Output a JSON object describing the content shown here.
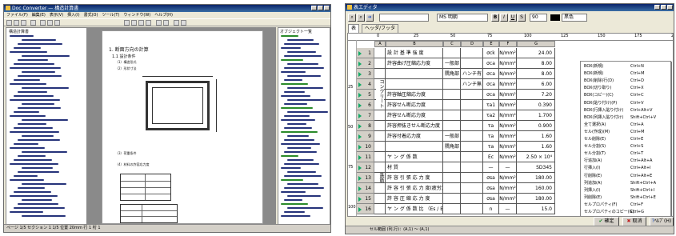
{
  "left_window": {
    "title": "Doc Converter — 構造計算書",
    "menus": [
      "ファイル(F)",
      "編集(E)",
      "表示(V)",
      "挿入(I)",
      "書式(O)",
      "ツール(T)",
      "ウィンドウ(W)",
      "ヘルプ(H)"
    ],
    "outline_title": "構造計算書",
    "page_heading": "1. 断面方向の計算",
    "page_sub1": "1.1 設計条件",
    "page_sub2": "（1）構造形式",
    "page_note": "（2）形状寸法",
    "page_caption": "（3）荷重条件",
    "page_caption2": "（4）材料の許容応力度",
    "status_text": "ページ 1/5   セクション 1   1/5   位置 20mm   行 1   桁 1",
    "right_panel_label": "オブジェクト一覧"
  },
  "right_window": {
    "title": "表エディタ",
    "font_name": "MS 明朝",
    "bold_label": "B",
    "italic_label": "I",
    "underline_label": "U",
    "strike_label": "S",
    "font_size": "90",
    "color_label": "黒色",
    "tabs": [
      "表",
      "ヘッダ/フッタ"
    ],
    "ruler_marks": [
      "0",
      "25",
      "50",
      "75",
      "100",
      "125",
      "150",
      "175",
      "200"
    ],
    "column_headers": [
      "A",
      "B",
      "C",
      "D",
      "E",
      "F",
      "G"
    ],
    "v_ruler": [
      "25",
      "50",
      "75",
      "100"
    ],
    "group_label_concrete": "コンクリート",
    "group_label_steel": "鉄筋",
    "rows": [
      {
        "num": "1",
        "b": "設 計 基 準 強 度",
        "c": "",
        "d": "",
        "e": "σck",
        "f": "N/mm²",
        "g": "24.00"
      },
      {
        "num": "2",
        "b": "許容曲げ圧縮応力度",
        "c": "一般部",
        "d": "",
        "e": "σca",
        "f": "N/mm²",
        "g": "8.00"
      },
      {
        "num": "3",
        "b": "",
        "c": "隅角部",
        "d": "ハンチ有",
        "e": "σca",
        "f": "N/mm²",
        "g": "8.00"
      },
      {
        "num": "4",
        "b": "",
        "c": "",
        "d": "ハンチ無",
        "e": "σca",
        "f": "N/mm²",
        "g": "6.00"
      },
      {
        "num": "5",
        "b": "許容軸圧縮応力度",
        "c": "",
        "d": "",
        "e": "σca",
        "f": "N/mm²",
        "g": "7.20"
      },
      {
        "num": "6",
        "b": "許容せん断応力度",
        "c": "",
        "d": "",
        "e": "τa1",
        "f": "N/mm²",
        "g": "0.390"
      },
      {
        "num": "7",
        "b": "許容せん断応力度",
        "c": "",
        "d": "",
        "e": "τa2",
        "f": "N/mm²",
        "g": "1.700"
      },
      {
        "num": "8",
        "b": "許容押抜きせん断応力度",
        "c": "",
        "d": "",
        "e": "τa",
        "f": "N/mm²",
        "g": "0.900"
      },
      {
        "num": "9",
        "b": "許容付着応力度",
        "c": "一般部",
        "d": "",
        "e": "τa",
        "f": "N/mm²",
        "g": "1.60"
      },
      {
        "num": "10",
        "b": "",
        "c": "隅角部",
        "d": "",
        "e": "τa",
        "f": "N/mm²",
        "g": "1.60"
      },
      {
        "num": "11",
        "b": "ヤ ン グ 係 数",
        "c": "",
        "d": "",
        "e": "Ec",
        "f": "N/mm²",
        "g": "2.50 × 10⁴"
      },
      {
        "num": "12",
        "b": "材 質",
        "c": "",
        "d": "",
        "e": "—",
        "f": "—",
        "g": "SD345"
      },
      {
        "num": "13",
        "b": "許 容 引 張 応 力 度",
        "c": "",
        "d": "",
        "e": "σsa",
        "f": "N/mm²",
        "g": "180.00"
      },
      {
        "num": "14",
        "b": "許 容 引 張 応 力 度(疲労)",
        "c": "",
        "d": "",
        "e": "σsa",
        "f": "N/mm²",
        "g": "160.00"
      },
      {
        "num": "15",
        "b": "許 容 圧 縮 応 力 度",
        "c": "",
        "d": "",
        "e": "σsa",
        "f": "N/mm²",
        "g": "180.00"
      },
      {
        "num": "16",
        "b": "ヤ ン グ 係 数 比 （Es / Ec）",
        "c": "",
        "d": "",
        "e": "n",
        "f": "—",
        "g": "15.0"
      }
    ],
    "context_menu": [
      {
        "label": "BOX(新規)",
        "shortcut": "Ctrl+N"
      },
      {
        "label": "BOX(新規)",
        "shortcut": "Ctrl+M"
      },
      {
        "label": "BOX(削除)行(D)",
        "shortcut": "Ctrl+D"
      },
      {
        "label": "BOX(切り取り)",
        "shortcut": "Ctrl+X"
      },
      {
        "label": "BOX(コピー)(C)",
        "shortcut": "Ctrl+C"
      },
      {
        "label": "BOX(貼り付け)(P)",
        "shortcut": "Ctrl+V"
      },
      {
        "label": "BOX(行挿入貼り付け)",
        "shortcut": "Ctrl+Alt+V"
      },
      {
        "label": "BOX(列挿入貼り付け)",
        "shortcut": "Shift+Ctrl+V"
      },
      {
        "label": "全て選択(A)",
        "shortcut": "Ctrl+A"
      },
      {
        "label": "セル(作成)(M)",
        "shortcut": "Ctrl+M"
      },
      {
        "label": "セル削除(E)",
        "shortcut": "Ctrl+E"
      },
      {
        "label": "セル分割(S)",
        "shortcut": "Ctrl+S"
      },
      {
        "label": "セル分割(T)",
        "shortcut": "Ctrl+T"
      },
      {
        "label": "行追加(A)",
        "shortcut": "Ctrl+Alt+A"
      },
      {
        "label": "行挿入(I)",
        "shortcut": "Ctrl+Alt+I"
      },
      {
        "label": "行削除(E)",
        "shortcut": "Ctrl+Alt+E"
      },
      {
        "label": "列追加(A)",
        "shortcut": "Shift+Ctrl+A"
      },
      {
        "label": "列挿入(I)",
        "shortcut": "Shift+Ctrl+I"
      },
      {
        "label": "列削除(E)",
        "shortcut": "Shift+Ctrl+E"
      },
      {
        "label": "セルプロパティ(F)",
        "shortcut": "Ctrl+F"
      },
      {
        "label": "セルプロパティのコピー(G)",
        "shortcut": "Ctrl+G"
      },
      {
        "label": "セルプロパティの貼り付け(H)",
        "shortcut": "Ctrl+H"
      },
      {
        "label": "プロパティ(P)",
        "shortcut": "Ctrl+P"
      }
    ],
    "ok_label": "確定",
    "cancel_label": "取消",
    "help_label": "ﾍﾙﾌﾟ(H)",
    "status_text": "セル範囲 (列,行)：(A,1) ～ (A,1)"
  },
  "colors": {
    "accent": "#0a246a",
    "window_bg": "#ece9d8",
    "tree_text": "#26337a",
    "row_tri": "#11aa66"
  }
}
